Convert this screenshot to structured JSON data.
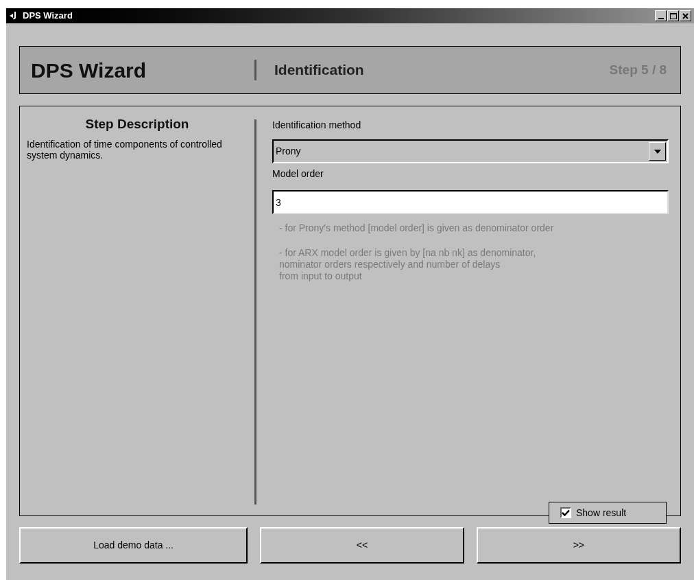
{
  "window": {
    "title": "DPS Wizard"
  },
  "header": {
    "app_name": "DPS Wizard",
    "step_name": "Identification",
    "step_counter": "Step 5 / 8"
  },
  "step_description": {
    "title": "Step Description",
    "text": "Identification of time components of controlled system dynamics."
  },
  "form": {
    "method_label": "Identification method",
    "method_value": "Prony",
    "order_label": "Model order",
    "order_value": "3",
    "notes": [
      "- for Prony's method [model order] is given as denominator order",
      "- for ARX  model order is given by [na nb nk] as denominator,\nnominator orders respectively and number of delays\nfrom input to output"
    ]
  },
  "show_result": {
    "label": "Show result",
    "checked": true
  },
  "buttons": [
    "Load demo data ...",
    "<<",
    ">>"
  ]
}
